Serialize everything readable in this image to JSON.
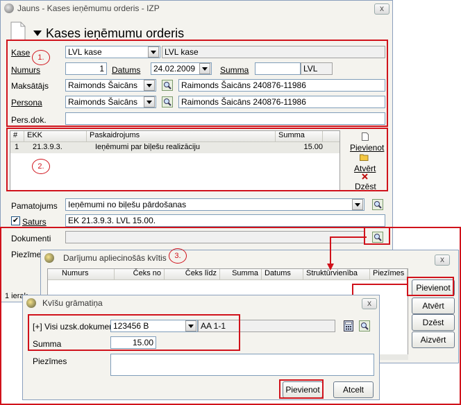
{
  "main_window": {
    "title": "Jauns - Kases ieņēmumu orderis - IZP",
    "close": "x",
    "heading": "Kases ieņēmumu orderis",
    "kase_label": "Kase",
    "kase_value": "LVL kase",
    "kase_name": "LVL kase",
    "numurs_label": "Numurs",
    "numurs_value": "1",
    "datums_label": "Datums",
    "datums_value": "24.02.2009",
    "summa_label": "Summa",
    "summa_value": "",
    "summa_currency": "LVL",
    "maksatajs_label": "Maksātājs",
    "maksatajs_value": "Raimonds Šaicāns",
    "maksatajs_full": "Raimonds Šaicāns 240876-11986",
    "persona_label": "Persona",
    "persona_value": "Raimonds Šaicāns",
    "persona_full": "Raimonds Šaicāns 240876-11986",
    "persdok_label": "Pers.dok.",
    "persdok_value": "",
    "table": {
      "columns": [
        "#",
        "EKK",
        "Paskaidrojums",
        "Summa"
      ],
      "rows": [
        {
          "num": "1",
          "ekk": "21.3.9.3.",
          "desc": "Ieņēmumi par biļešu realizāciju",
          "sum": "15.00"
        }
      ]
    },
    "side_buttons": {
      "add": "Pievienot",
      "open": "Atvērt",
      "delete": "Dzēst"
    },
    "pamatojums_label": "Pamatojums",
    "pamatojums_value": "Ieņēmumi no biļešu pārdošanas",
    "saturs_label": "Saturs",
    "saturs_value": "EK 21.3.9.3. LVL 15.00.",
    "dokumenti_label": "Dokumenti",
    "piezimes_label": "Piezīmes",
    "status_text": "1 ierak"
  },
  "annotations": {
    "one": "1.",
    "two": "2.",
    "three": "3."
  },
  "dialog1": {
    "title": "Darījumu apliecinošās kvītis",
    "close": "x",
    "columns": [
      "Numurs",
      "Čeks no",
      "Čeks līdz",
      "Summa",
      "Datums",
      "Struktūrvienība",
      "Piezīmes"
    ],
    "buttons": {
      "add": "Pievienot",
      "open": "Atvērt",
      "delete": "Dzēst",
      "close": "Aizvērt"
    }
  },
  "dialog2": {
    "title": "Kvīšu grāmatiņa",
    "close": "x",
    "visi_label": "[+] Visi uzsk.dokumenti",
    "visi_value": "123456 B",
    "visi_name": "AA 1-1",
    "summa_label": "Summa",
    "summa_value": "15.00",
    "piezimes_label": "Piezīmes",
    "piezimes_value": "",
    "add_button": "Pievienot",
    "cancel_button": "Atcelt"
  },
  "colors": {
    "annotation_red": "#d0121b",
    "window_bg": "#f4f3ee"
  }
}
